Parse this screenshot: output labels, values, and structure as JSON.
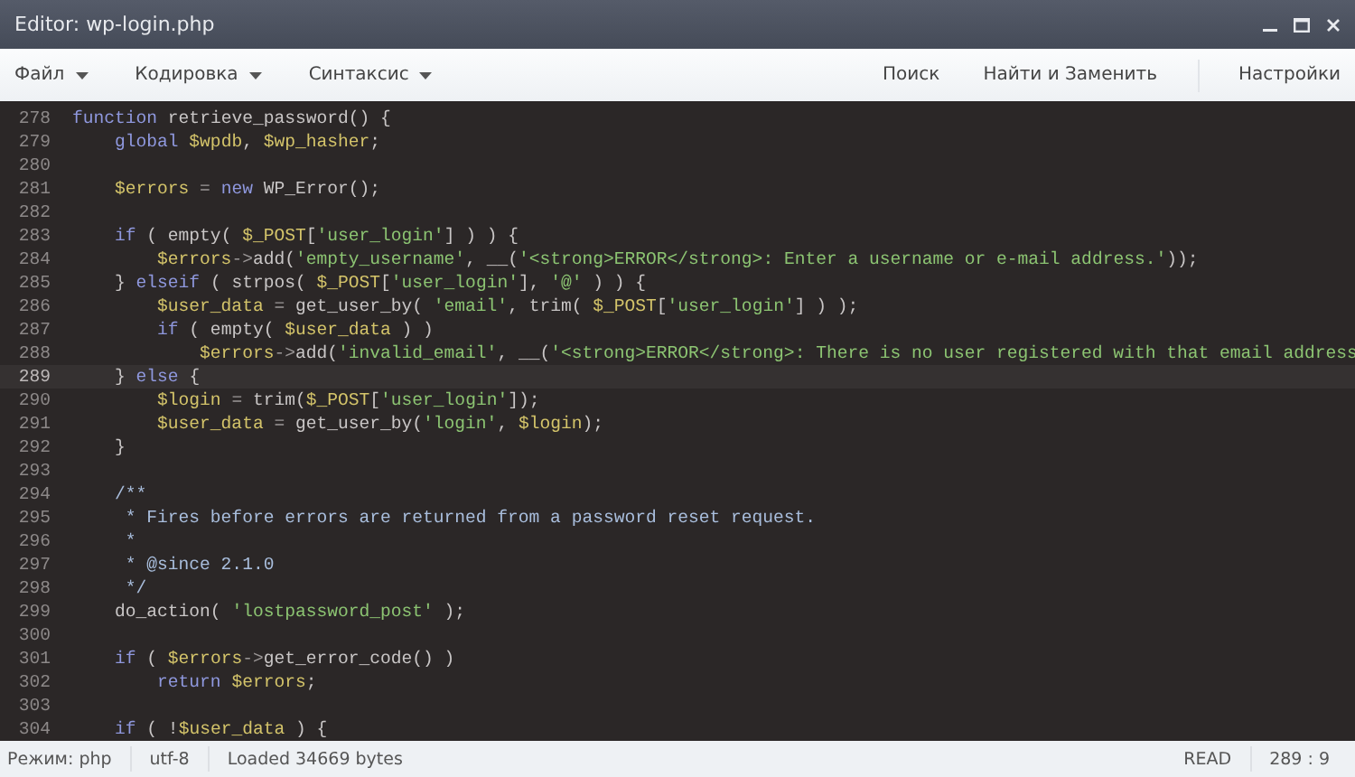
{
  "window": {
    "title": "Editor: wp-login.php"
  },
  "menu": {
    "left": [
      {
        "label": "Файл"
      },
      {
        "label": "Кодировка"
      },
      {
        "label": "Синтаксис"
      }
    ],
    "right": [
      {
        "label": "Поиск"
      },
      {
        "label": "Найти и Заменить"
      },
      {
        "label": "Настройки"
      }
    ]
  },
  "editor": {
    "lines": [
      {
        "number": "278",
        "current": false,
        "tokens": [
          {
            "kind": "kw",
            "text": "function"
          },
          {
            "kind": "plain",
            "text": " retrieve_password() {"
          }
        ]
      },
      {
        "number": "279",
        "current": false,
        "tokens": [
          {
            "kind": "kw",
            "text": "    global"
          },
          {
            "kind": "var",
            "text": " $wpdb"
          },
          {
            "kind": "plain",
            "text": ", "
          },
          {
            "kind": "var",
            "text": "$wp_hasher"
          },
          {
            "kind": "plain",
            "text": ";"
          }
        ]
      },
      {
        "number": "280",
        "current": false
      },
      {
        "number": "281",
        "current": false,
        "tokens": [
          {
            "kind": "var",
            "text": "    $errors"
          },
          {
            "kind": "op",
            "text": " = "
          },
          {
            "kind": "kw",
            "text": "new"
          },
          {
            "kind": "plain",
            "text": " WP_Error();"
          }
        ]
      },
      {
        "number": "282",
        "current": false
      },
      {
        "number": "283",
        "current": false,
        "tokens": [
          {
            "kind": "kw",
            "text": "    if"
          },
          {
            "kind": "plain",
            "text": " ( empty( "
          },
          {
            "kind": "var",
            "text": "$_POST"
          },
          {
            "kind": "plain",
            "text": "["
          },
          {
            "kind": "str",
            "text": "'user_login'"
          },
          {
            "kind": "plain",
            "text": "] ) ) {"
          }
        ]
      },
      {
        "number": "284",
        "current": false,
        "tokens": [
          {
            "kind": "var",
            "text": "        $errors"
          },
          {
            "kind": "op",
            "text": "->"
          },
          {
            "kind": "plain",
            "text": "add("
          },
          {
            "kind": "str",
            "text": "'empty_username'"
          },
          {
            "kind": "plain",
            "text": ", __("
          },
          {
            "kind": "str",
            "text": "'<strong>ERROR</strong>: Enter a username or e-mail address.'"
          },
          {
            "kind": "plain",
            "text": "));"
          }
        ]
      },
      {
        "number": "285",
        "current": false,
        "tokens": [
          {
            "kind": "plain",
            "text": "    } "
          },
          {
            "kind": "kw",
            "text": "elseif"
          },
          {
            "kind": "plain",
            "text": " ( strpos( "
          },
          {
            "kind": "var",
            "text": "$_POST"
          },
          {
            "kind": "plain",
            "text": "["
          },
          {
            "kind": "str",
            "text": "'user_login'"
          },
          {
            "kind": "plain",
            "text": "], "
          },
          {
            "kind": "str",
            "text": "'@'"
          },
          {
            "kind": "plain",
            "text": " ) ) {"
          }
        ]
      },
      {
        "number": "286",
        "current": false,
        "tokens": [
          {
            "kind": "var",
            "text": "        $user_data"
          },
          {
            "kind": "op",
            "text": " = "
          },
          {
            "kind": "plain",
            "text": "get_user_by( "
          },
          {
            "kind": "str",
            "text": "'email'"
          },
          {
            "kind": "plain",
            "text": ", trim( "
          },
          {
            "kind": "var",
            "text": "$_POST"
          },
          {
            "kind": "plain",
            "text": "["
          },
          {
            "kind": "str",
            "text": "'user_login'"
          },
          {
            "kind": "plain",
            "text": "] ) );"
          }
        ]
      },
      {
        "number": "287",
        "current": false,
        "tokens": [
          {
            "kind": "kw",
            "text": "        if"
          },
          {
            "kind": "plain",
            "text": " ( empty( "
          },
          {
            "kind": "var",
            "text": "$user_data"
          },
          {
            "kind": "plain",
            "text": " ) )"
          }
        ]
      },
      {
        "number": "288",
        "current": false,
        "tokens": [
          {
            "kind": "var",
            "text": "            $errors"
          },
          {
            "kind": "op",
            "text": "->"
          },
          {
            "kind": "plain",
            "text": "add("
          },
          {
            "kind": "str",
            "text": "'invalid_email'"
          },
          {
            "kind": "plain",
            "text": ", __("
          },
          {
            "kind": "str",
            "text": "'<strong>ERROR</strong>: There is no user registered with that email address"
          }
        ]
      },
      {
        "number": "289",
        "current": true,
        "tokens": [
          {
            "kind": "plain",
            "text": "    } "
          },
          {
            "kind": "kw",
            "text": "else"
          },
          {
            "kind": "plain",
            "text": " {"
          }
        ]
      },
      {
        "number": "290",
        "current": false,
        "tokens": [
          {
            "kind": "var",
            "text": "        $login"
          },
          {
            "kind": "op",
            "text": " = "
          },
          {
            "kind": "plain",
            "text": "trim("
          },
          {
            "kind": "var",
            "text": "$_POST"
          },
          {
            "kind": "plain",
            "text": "["
          },
          {
            "kind": "str",
            "text": "'user_login'"
          },
          {
            "kind": "plain",
            "text": "]);"
          }
        ]
      },
      {
        "number": "291",
        "current": false,
        "tokens": [
          {
            "kind": "var",
            "text": "        $user_data"
          },
          {
            "kind": "op",
            "text": " = "
          },
          {
            "kind": "plain",
            "text": "get_user_by("
          },
          {
            "kind": "str",
            "text": "'login'"
          },
          {
            "kind": "plain",
            "text": ", "
          },
          {
            "kind": "var",
            "text": "$login"
          },
          {
            "kind": "plain",
            "text": ");"
          }
        ]
      },
      {
        "number": "292",
        "current": false,
        "tokens": [
          {
            "kind": "plain",
            "text": "    }"
          }
        ]
      },
      {
        "number": "293",
        "current": false
      },
      {
        "number": "294",
        "current": false,
        "tokens": [
          {
            "kind": "cmt",
            "text": "    /**"
          }
        ]
      },
      {
        "number": "295",
        "current": false,
        "tokens": [
          {
            "kind": "cmt",
            "text": "     * Fires before errors are returned from a password reset request."
          }
        ]
      },
      {
        "number": "296",
        "current": false,
        "tokens": [
          {
            "kind": "cmt",
            "text": "     *"
          }
        ]
      },
      {
        "number": "297",
        "current": false,
        "tokens": [
          {
            "kind": "cmt",
            "text": "     * @since 2.1.0"
          }
        ]
      },
      {
        "number": "298",
        "current": false,
        "tokens": [
          {
            "kind": "cmt",
            "text": "     */"
          }
        ]
      },
      {
        "number": "299",
        "current": false,
        "tokens": [
          {
            "kind": "plain",
            "text": "    do_action( "
          },
          {
            "kind": "str",
            "text": "'lostpassword_post'"
          },
          {
            "kind": "plain",
            "text": " );"
          }
        ]
      },
      {
        "number": "300",
        "current": false
      },
      {
        "number": "301",
        "current": false,
        "tokens": [
          {
            "kind": "kw",
            "text": "    if"
          },
          {
            "kind": "plain",
            "text": " ( "
          },
          {
            "kind": "var",
            "text": "$errors"
          },
          {
            "kind": "op",
            "text": "->"
          },
          {
            "kind": "plain",
            "text": "get_error_code() )"
          }
        ]
      },
      {
        "number": "302",
        "current": false,
        "tokens": [
          {
            "kind": "kw",
            "text": "        return"
          },
          {
            "kind": "var",
            "text": " $errors"
          },
          {
            "kind": "plain",
            "text": ";"
          }
        ]
      },
      {
        "number": "303",
        "current": false
      },
      {
        "number": "304",
        "current": false,
        "tokens": [
          {
            "kind": "kw",
            "text": "    if"
          },
          {
            "kind": "plain",
            "text": " ( !"
          },
          {
            "kind": "var",
            "text": "$user_data"
          },
          {
            "kind": "plain",
            "text": " ) {"
          }
        ]
      }
    ]
  },
  "status_bar": {
    "mode": "Режим: php",
    "encoding": "utf-8",
    "info": "Loaded 34669 bytes",
    "access": "READ",
    "position": "289 : 9"
  }
}
